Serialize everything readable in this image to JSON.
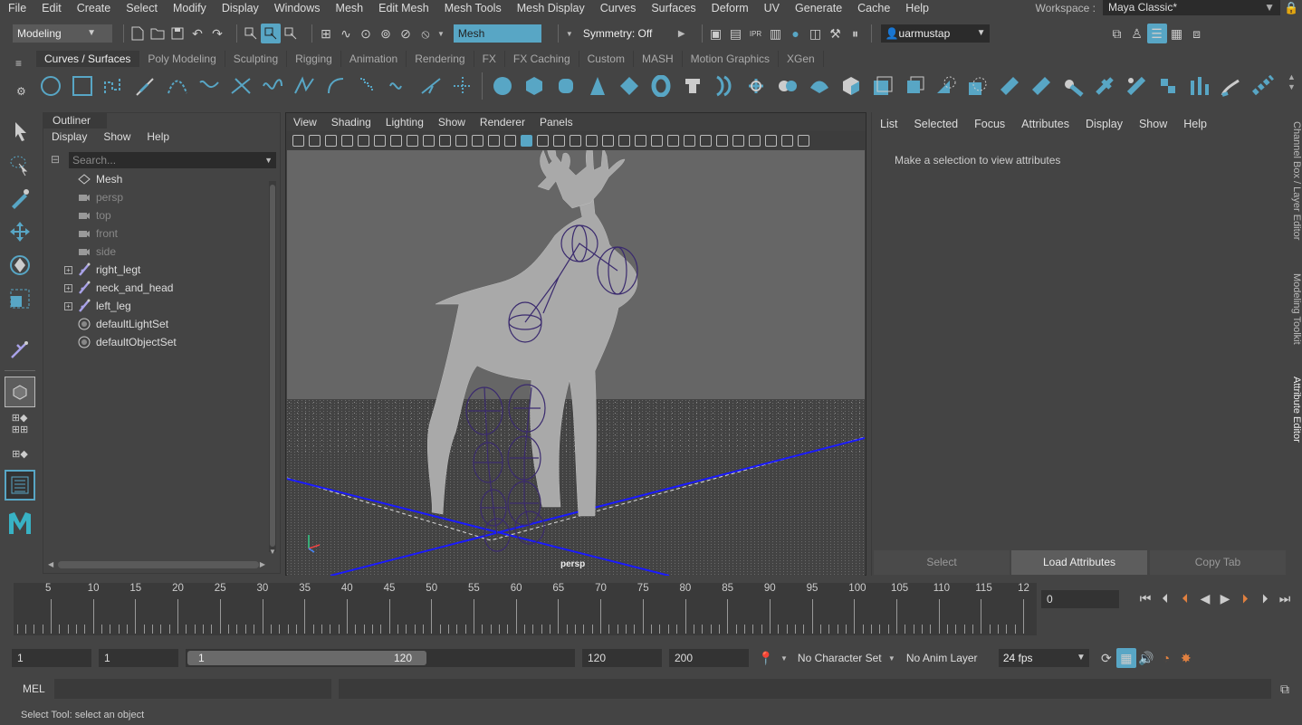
{
  "menu": [
    "File",
    "Edit",
    "Create",
    "Select",
    "Modify",
    "Display",
    "Windows",
    "Mesh",
    "Edit Mesh",
    "Mesh Tools",
    "Mesh Display",
    "Curves",
    "Surfaces",
    "Deform",
    "UV",
    "Generate",
    "Cache",
    "Help"
  ],
  "workspace": {
    "label": "Workspace :",
    "value": "Maya Classic*"
  },
  "status": {
    "mode": "Modeling",
    "selmode": "Mesh",
    "symmetry": "Symmetry: Off",
    "user": "uarmustap"
  },
  "shelf_tabs": [
    "Curves / Surfaces",
    "Poly Modeling",
    "Sculpting",
    "Rigging",
    "Animation",
    "Rendering",
    "FX",
    "FX Caching",
    "Custom",
    "MASH",
    "Motion Graphics",
    "XGen"
  ],
  "outliner": {
    "title": "Outliner",
    "menu": [
      "Display",
      "Show",
      "Help"
    ],
    "search_placeholder": "Search...",
    "items": [
      {
        "label": "Mesh",
        "icon": "mesh-icon",
        "dim": false,
        "expand": false
      },
      {
        "label": "persp",
        "icon": "camera-icon",
        "dim": true,
        "expand": false
      },
      {
        "label": "top",
        "icon": "camera-icon",
        "dim": true,
        "expand": false
      },
      {
        "label": "front",
        "icon": "camera-icon",
        "dim": true,
        "expand": false
      },
      {
        "label": "side",
        "icon": "camera-icon",
        "dim": true,
        "expand": false
      },
      {
        "label": "right_legt",
        "icon": "joint-icon",
        "dim": false,
        "expand": true
      },
      {
        "label": "neck_and_head",
        "icon": "joint-icon",
        "dim": false,
        "expand": true
      },
      {
        "label": "left_leg",
        "icon": "joint-icon",
        "dim": false,
        "expand": true
      },
      {
        "label": "defaultLightSet",
        "icon": "set-icon",
        "dim": false,
        "expand": false
      },
      {
        "label": "defaultObjectSet",
        "icon": "set-icon",
        "dim": false,
        "expand": false
      }
    ]
  },
  "viewport": {
    "menu": [
      "View",
      "Shading",
      "Lighting",
      "Show",
      "Renderer",
      "Panels"
    ],
    "camera": "persp"
  },
  "attr": {
    "menu": [
      "List",
      "Selected",
      "Focus",
      "Attributes",
      "Display",
      "Show",
      "Help"
    ],
    "message": "Make a selection to view attributes",
    "buttons": [
      "Select",
      "Load Attributes",
      "Copy Tab"
    ]
  },
  "side_tabs": [
    "Channel Box / Layer Editor",
    "Modeling Toolkit",
    "Attribute Editor"
  ],
  "timeline": {
    "ticks": [
      "5",
      "10",
      "15",
      "20",
      "25",
      "30",
      "35",
      "40",
      "45",
      "50",
      "55",
      "60",
      "65",
      "70",
      "75",
      "80",
      "85",
      "90",
      "95",
      "100",
      "105",
      "110",
      "115",
      "12"
    ],
    "current": "0"
  },
  "range": {
    "start": "1",
    "inner_start": "1",
    "slider_start": "1",
    "slider_end": "120",
    "inner_end": "120",
    "end": "200",
    "charset": "No Character Set",
    "animlayer": "No Anim Layer",
    "fps": "24 fps"
  },
  "cmd": {
    "label": "MEL"
  },
  "help": "Select Tool: select an object",
  "colors": {
    "accent": "#58a6c5",
    "joint": "#3a2a6e",
    "axis": "#1a1aff"
  }
}
